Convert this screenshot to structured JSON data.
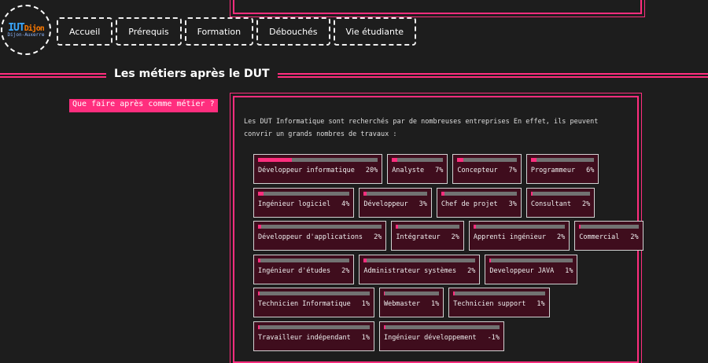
{
  "logo": {
    "main_a": "IUT",
    "main_b": "Dijon",
    "sub": "Dijon-Auxerre"
  },
  "nav": [
    "Accueil",
    "Prérequis",
    "Formation",
    "Débouchés",
    "Vie étudiante"
  ],
  "section_title": "Les métiers après le DUT",
  "side_link": "Que faire après comme métier ?",
  "intro": "Les DUT Informatique sont recherchés par de nombreuses entreprises En effet, ils peuvent convrir un grands nombres de travaux :",
  "colors": {
    "accent": "#ff2e7e",
    "background": "#1d1d1d",
    "card": "#3f0d1d",
    "track": "#727272"
  },
  "jobs": [
    [
      {
        "label": "Développeur informatique",
        "pct": "20%",
        "fill": 0.2
      },
      {
        "label": "Analyste",
        "pct": "7%",
        "fill": 0.07
      },
      {
        "label": "Concepteur",
        "pct": "7%",
        "fill": 0.07
      },
      {
        "label": "Programmeur",
        "pct": "6%",
        "fill": 0.06
      }
    ],
    [
      {
        "label": "Ingénieur logiciel",
        "pct": "4%",
        "fill": 0.04
      },
      {
        "label": "Développeur",
        "pct": "3%",
        "fill": 0.03
      },
      {
        "label": "Chef de projet",
        "pct": "3%",
        "fill": 0.03
      },
      {
        "label": "Consultant",
        "pct": "2%",
        "fill": 0.02
      }
    ],
    [
      {
        "label": "Développeur d'applications",
        "pct": "2%",
        "fill": 0.02
      },
      {
        "label": "Intégrateur",
        "pct": "2%",
        "fill": 0.02
      },
      {
        "label": "Apprenti ingénieur",
        "pct": "2%",
        "fill": 0.02
      },
      {
        "label": "Commercial",
        "pct": "2%",
        "fill": 0.02
      }
    ],
    [
      {
        "label": "Ingénieur d'études",
        "pct": "2%",
        "fill": 0.02
      },
      {
        "label": "Administrateur systèmes",
        "pct": "2%",
        "fill": 0.02
      },
      {
        "label": "Developpeur JAVA",
        "pct": "1%",
        "fill": 0.01
      }
    ],
    [
      {
        "label": "Technicien Informatique",
        "pct": "1%",
        "fill": 0.01
      },
      {
        "label": "Webmaster",
        "pct": "1%",
        "fill": 0.01
      },
      {
        "label": "Technicien support",
        "pct": "1%",
        "fill": 0.01
      }
    ],
    [
      {
        "label": "Travailleur indépendant",
        "pct": "1%",
        "fill": 0.01
      },
      {
        "label": "Ingénieur développement",
        "pct": "-1%",
        "fill": 0.005
      }
    ]
  ]
}
